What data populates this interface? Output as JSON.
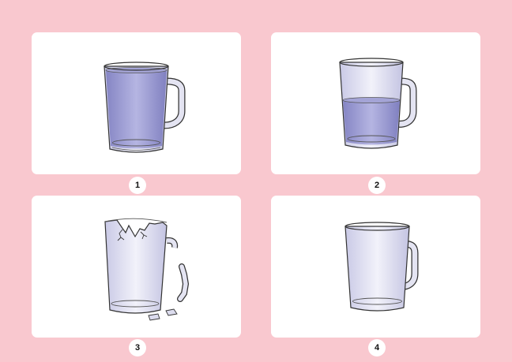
{
  "background_color": "#f9c8cf",
  "panels": [
    {
      "id": 1,
      "label": "1",
      "state": "full-cup-icon"
    },
    {
      "id": 2,
      "label": "2",
      "state": "half-full-cup-icon"
    },
    {
      "id": 3,
      "label": "3",
      "state": "broken-cup-icon"
    },
    {
      "id": 4,
      "label": "4",
      "state": "empty-cup-icon"
    }
  ],
  "colors": {
    "glass_fill": "#dcdcee",
    "liquid": "#9a9ad2",
    "outline": "#333333"
  }
}
